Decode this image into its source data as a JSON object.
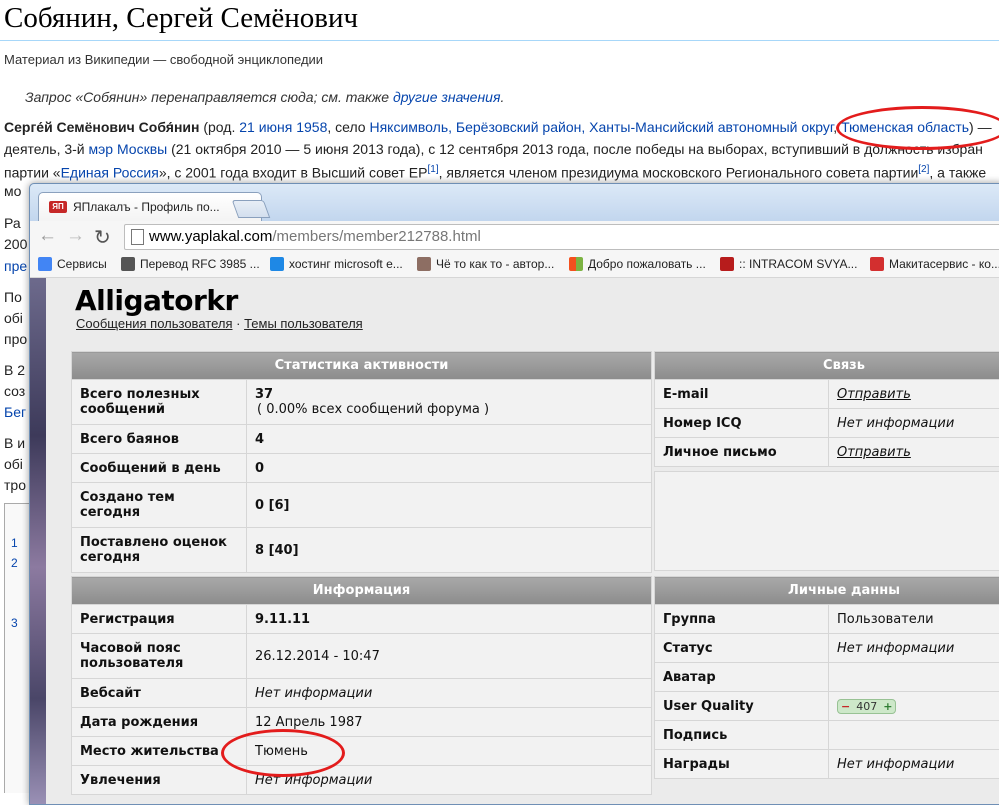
{
  "wiki": {
    "title": "Собянин, Сергей Семёнович",
    "subtitle": "Материал из Википедии — свободной энциклопедии",
    "redirect_prefix": "Запрос «Собянин» перенаправляется сюда; см. также ",
    "redirect_link": "другие значения",
    "redirect_suffix": ".",
    "line1_name": "Серге́й Семёнович Собя́нин",
    "line1_a": " (род. ",
    "line1_date_link": "21 июня 1958",
    "line1_b": ", село ",
    "line1_place_link": "Няксимволь, Берёзовский район, Ханты-Мансийский автономный округ",
    "line1_c": ", ",
    "line1_region_link": "Тюменская область",
    "line1_d": ") —",
    "line2_a": "деятель, 3-й ",
    "line2_link": "мэр Москвы",
    "line2_b": " (21 октября 2010 — 5 июня 2013 года), с 12 сентября 2013 года, после победы на выборах, вступивший в должность избран",
    "line3_a": "партии «",
    "line3_link": "Единая Россия",
    "line3_b": "», с 2001 года входит в Высший совет ЕР",
    "line3_sup1": "[1]",
    "line3_c": ", является членом президиума московского Регионального совета партии",
    "line3_sup2": "[2]",
    "line3_d": ", а также",
    "line4": "мо",
    "fragments": [
      "Ра",
      "200",
      "пре",
      "По",
      "обі",
      "про",
      "В 2",
      "соз",
      "Бег",
      "В и",
      "обі",
      "тро"
    ],
    "toc_numbers": [
      "1",
      "2",
      "3"
    ]
  },
  "browser": {
    "tab_favicon": "ЯП",
    "tab_title": "ЯПлакалъ - Профиль по...",
    "tab_close": "×",
    "url_host": "www.yaplakal.com",
    "url_path": "/members/member212788.html",
    "nav": {
      "back": "←",
      "forward": "→",
      "reload": "↻"
    },
    "bookmarks": [
      {
        "label": "Сервисы",
        "color": "#4285f4"
      },
      {
        "label": "Перевод RFC 3985 ...",
        "color": "#555555"
      },
      {
        "label": "хостинг microsoft e...",
        "color": "#1e88e5"
      },
      {
        "label": "Чё то как то - автор...",
        "color": "#8d6e63"
      },
      {
        "label": "Добро пожаловать ...",
        "color": "#f4511e"
      },
      {
        "label": ":: INTRACOM SVYA...",
        "color": "#b71c1c"
      },
      {
        "label": "Макитасервис - ко...",
        "color": "#d32f2f"
      }
    ]
  },
  "profile": {
    "username": "Alligatorkr",
    "link_messages": "Сообщения пользователя",
    "link_sep": " · ",
    "link_topics": "Темы пользователя",
    "stats": {
      "header": "Статистика активности",
      "rows": [
        {
          "label": "Всего полезных сообщений",
          "value": "37",
          "value2": "( 0.00% всех сообщений форума )"
        },
        {
          "label": "Всего баянов",
          "value": "4"
        },
        {
          "label": "Сообщений в день",
          "value": "0"
        },
        {
          "label": "Создано тем сегодня",
          "value": "0 [6]"
        },
        {
          "label": "Поставлено оценок сегодня",
          "value": "8 [40]"
        }
      ]
    },
    "contact": {
      "header": "Связь",
      "rows": [
        {
          "label": "E-mail",
          "value": "Отправить"
        },
        {
          "label": "Номер ICQ",
          "value": "Нет информации"
        },
        {
          "label": "Личное письмо",
          "value": "Отправить"
        }
      ]
    },
    "info": {
      "header": "Информация",
      "rows": [
        {
          "label": "Регистрация",
          "value": "9.11.11"
        },
        {
          "label": "Часовой пояс пользователя",
          "value": "26.12.2014 - 10:47"
        },
        {
          "label": "Вебсайт",
          "value": "Нет информации"
        },
        {
          "label": "Дата рождения",
          "value": "12 Апрель 1987"
        },
        {
          "label": "Место жительства",
          "value": "Тюмень"
        },
        {
          "label": "Увлечения",
          "value": "Нет информации"
        }
      ]
    },
    "personal": {
      "header": "Личные данны",
      "rows": [
        {
          "label": "Группа",
          "value": "Пользователи"
        },
        {
          "label": "Статус",
          "value": "Нет информации"
        },
        {
          "label": "Аватар",
          "value": ""
        },
        {
          "label": "User Quality",
          "value": "407",
          "minus": "−",
          "plus": "+"
        },
        {
          "label": "Подпись",
          "value": ""
        },
        {
          "label": "Награды",
          "value": "Нет информации"
        }
      ]
    }
  },
  "colors": {
    "annotation": "#e31c1c",
    "wiki_link": "#0645ad",
    "table_header": "#999999"
  }
}
